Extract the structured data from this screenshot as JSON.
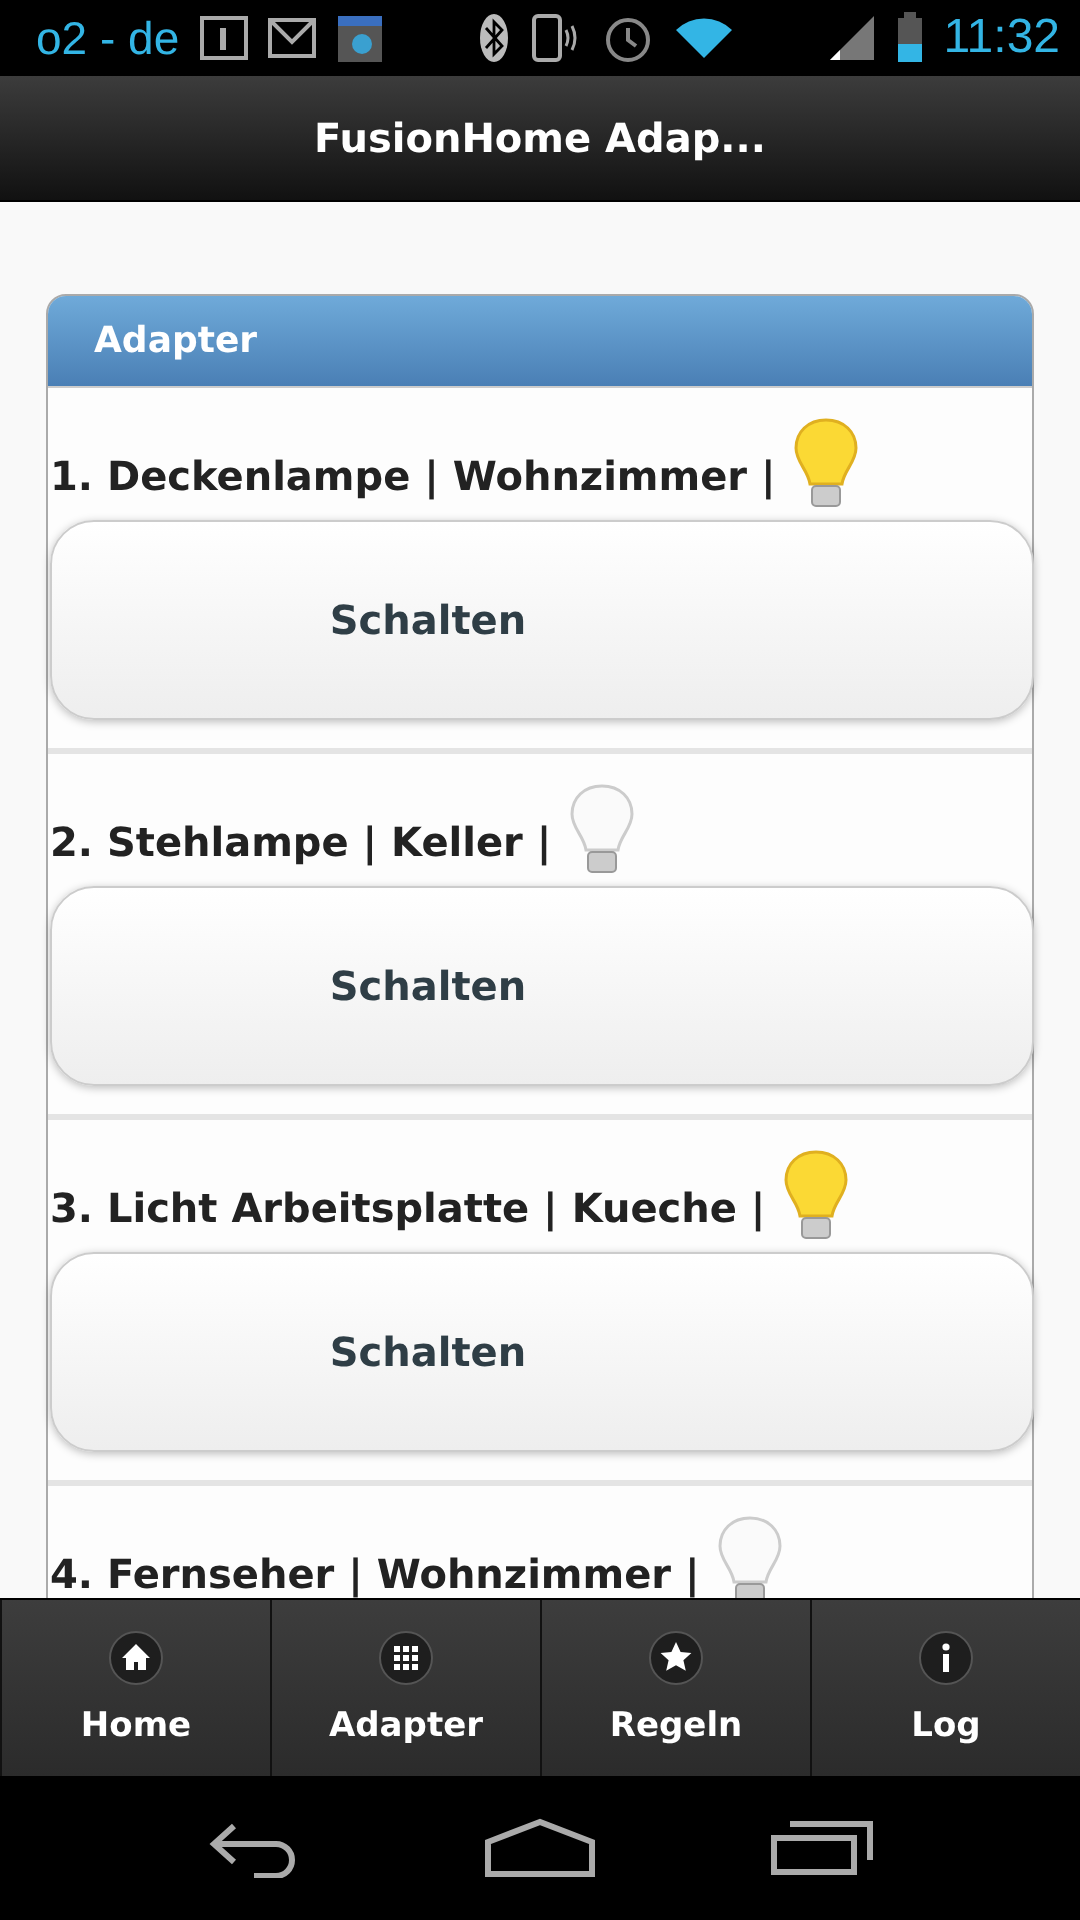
{
  "status_bar": {
    "carrier": "o2 - de",
    "time": "11:32"
  },
  "header": {
    "title": "FusionHome Adap..."
  },
  "card": {
    "title": "Adapter",
    "items": [
      {
        "label": "1. Deckenlampe | Wohnzimmer |",
        "on": true,
        "button": "Schalten"
      },
      {
        "label": "2. Stehlampe | Keller |",
        "on": false,
        "button": "Schalten"
      },
      {
        "label": "3. Licht Arbeitsplatte | Kueche |",
        "on": true,
        "button": "Schalten"
      },
      {
        "label": "4. Fernseher | Wohnzimmer |",
        "on": false
      }
    ]
  },
  "tab_bar": [
    {
      "label": "Home",
      "kind": "home"
    },
    {
      "label": "Adapter",
      "kind": "grid"
    },
    {
      "label": "Regeln",
      "kind": "star"
    },
    {
      "label": "Log",
      "kind": "info"
    }
  ]
}
